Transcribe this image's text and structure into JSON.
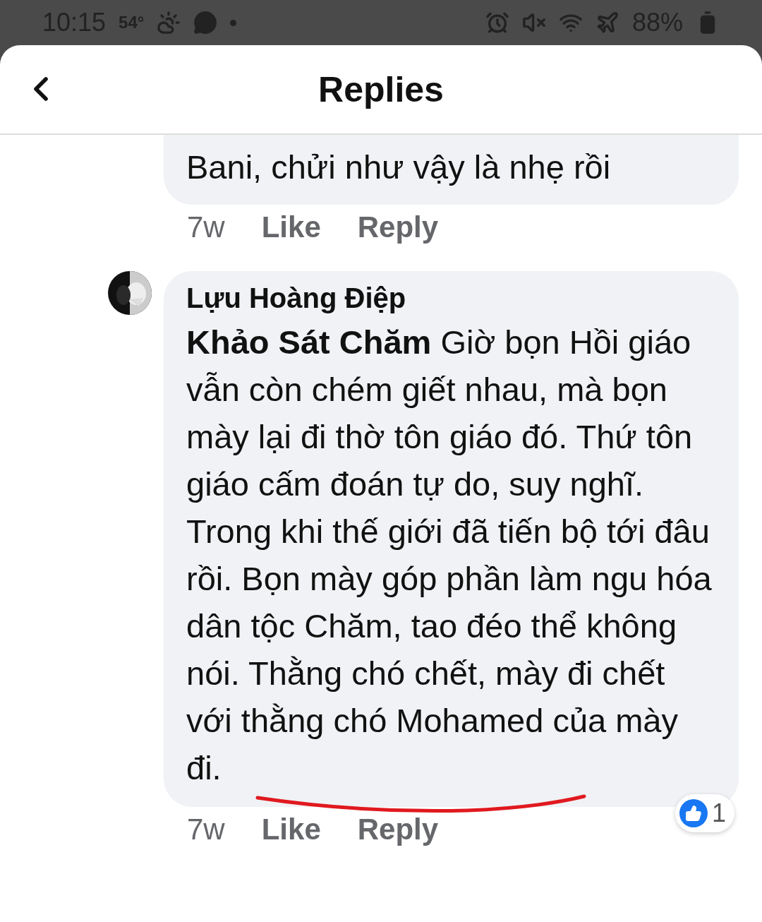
{
  "status_bar": {
    "time": "10:15",
    "temperature": "54°",
    "battery": "88%"
  },
  "header": {
    "title": "Replies"
  },
  "comments": [
    {
      "kind": "continued",
      "body": "Bani, chửi như vậy là nhẹ rồi",
      "actions": {
        "time": "7w",
        "like": "Like",
        "reply": "Reply"
      }
    },
    {
      "kind": "full",
      "author": "Lựu Hoàng Điệp",
      "body": "**Khảo Sát Chăm** Giờ bọn Hồi giáo vẫn còn chém giết nhau, mà bọn mày lại đi thờ tôn giáo đó. Thứ tôn giáo cấm đoán tự do, suy nghĩ. Trong khi thế giới đã tiến bộ tới đâu rồi. Bọn mày góp phần làm ngu hóa dân tộc Chăm, tao đéo thể không nói. Thằng chó chết, mày đi chết với thằng chó Mohamed của mày đi.",
      "actions": {
        "time": "7w",
        "like": "Like",
        "reply": "Reply"
      },
      "reactions": "1"
    }
  ]
}
